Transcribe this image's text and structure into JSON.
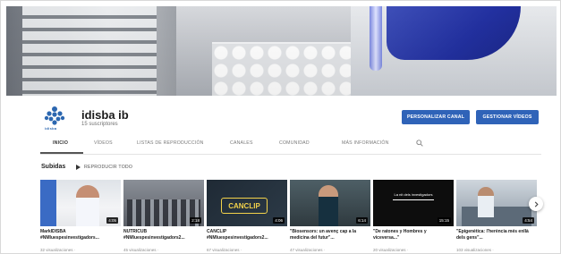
{
  "channel": {
    "name": "idisba ib",
    "subscribers": "15 suscriptores",
    "logo_text": "idisba",
    "buttons": {
      "customize": "PERSONALIZAR CANAL",
      "manage": "GESTIONAR VÍDEOS"
    }
  },
  "tabs": [
    {
      "label": "INICIO",
      "active": true
    },
    {
      "label": "VÍDEOS",
      "active": false
    },
    {
      "label": "LISTAS DE REPRODUCCIÓN",
      "active": false
    },
    {
      "label": "CANALES",
      "active": false
    },
    {
      "label": "COMUNIDAD",
      "active": false
    },
    {
      "label": "MÁS INFORMACIÓN",
      "active": false
    }
  ],
  "section": {
    "title": "Subidas",
    "play_all": "REPRODUCIR TODO"
  },
  "videos": [
    {
      "title": "MarkIDISBA #NMIuespesinvestigadors...",
      "meta": "32 visualizaciones · ",
      "duration": "4:05"
    },
    {
      "title": "NUTRICUB #NMIuespesinvestigadors2...",
      "meta": "45 visualizaciones · ",
      "duration": "2:18"
    },
    {
      "title": "CANCLIP #NMIuespesinvestigadors2...",
      "meta": "67 visualizaciones · ",
      "duration": "4:06"
    },
    {
      "title": "\"Biosensors: un avenç cap a la medicina del futur\"...",
      "meta": "47 visualizaciones · ",
      "duration": "6:14"
    },
    {
      "title": "\"De ratones y Hombres y viceversa...\"",
      "meta": "20 visualizaciones · ",
      "duration": "15:15"
    },
    {
      "title": "\"Epigenètica: l'herència més enllà dels gens\"...",
      "meta": "103 visualizaciones · ",
      "duration": "4:54"
    }
  ],
  "thumb_text": {
    "canclip": "CANCLIP",
    "investigadors": "La nit dels investigadors"
  },
  "colors": {
    "accent": "#2f63b8",
    "logo": "#2c67b0"
  },
  "icons": {
    "search": "search-icon",
    "next": "chevron-right-icon"
  }
}
